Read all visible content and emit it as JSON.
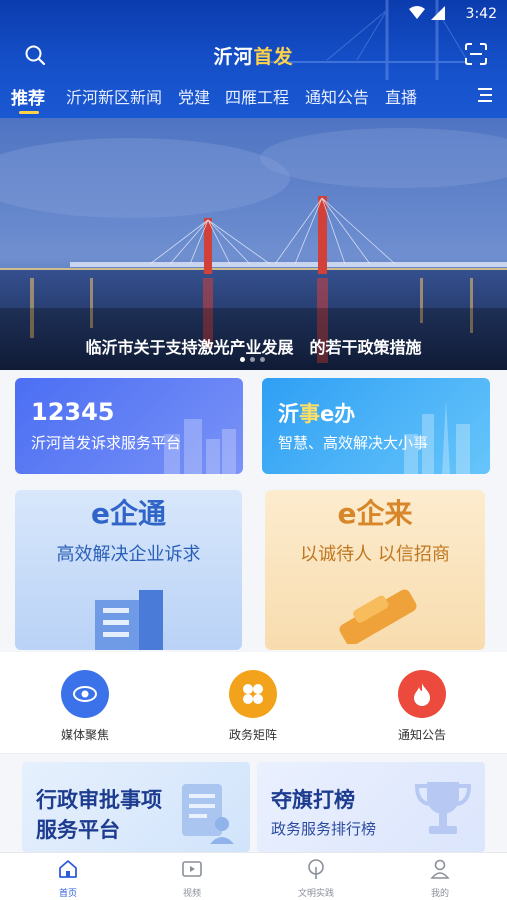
{
  "status_bar": {
    "time": "3:42"
  },
  "header": {
    "title_part1": "沂河",
    "title_part2": "首发"
  },
  "tabs": [
    {
      "label": "推荐",
      "active": true
    },
    {
      "label": "沂河新区新闻",
      "active": false
    },
    {
      "label": "党建",
      "active": false
    },
    {
      "label": "四雁工程",
      "active": false
    },
    {
      "label": "通知公告",
      "active": false
    },
    {
      "label": "直播",
      "active": false
    }
  ],
  "banner": {
    "caption": "临沂市关于支持激光产业发展　的若干政策措施",
    "dots": 3,
    "active_dot": 0
  },
  "cards": {
    "hotline": {
      "title": "12345",
      "subtitle": "沂河首发诉求服务平台"
    },
    "yishi": {
      "title_a": "沂",
      "title_b": "事",
      "title_c": "e办",
      "subtitle": "智慧、高效解决大小事"
    },
    "eqitong": {
      "title": "e企通",
      "subtitle": "高效解决企业诉求"
    },
    "eqilai": {
      "title": "e企来",
      "subtitle": "以诚待人 以信招商"
    }
  },
  "icon_row": [
    {
      "label": "媒体聚焦",
      "icon": "eye-icon",
      "color": "#3b72ea"
    },
    {
      "label": "政务矩阵",
      "icon": "grid-icon",
      "color": "#f3a21c"
    },
    {
      "label": "通知公告",
      "icon": "flame-icon",
      "color": "#ec4a3c"
    }
  ],
  "promos": {
    "left": {
      "line1": "行政审批事项",
      "line2": "服务平台"
    },
    "right": {
      "line1": "夺旗打榜",
      "line2": "政务服务排行榜"
    }
  },
  "bottom_nav": [
    {
      "label": "首页",
      "icon": "home-icon",
      "active": true
    },
    {
      "label": "视频",
      "icon": "video-icon",
      "active": false
    },
    {
      "label": "文明实践",
      "icon": "leaf-icon",
      "active": false
    },
    {
      "label": "我的",
      "icon": "user-icon",
      "active": false
    }
  ],
  "colors": {
    "primary": "#1550c9",
    "accent": "#ffd24a",
    "nav_active": "#2d5ed8"
  }
}
